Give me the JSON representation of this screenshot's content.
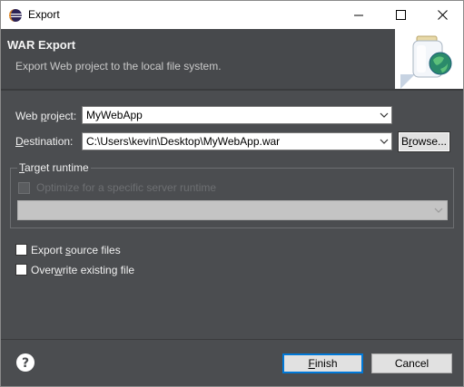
{
  "window": {
    "title": "Export",
    "controls": {
      "minimize": "—",
      "maximize": "☐",
      "close": "✕"
    }
  },
  "banner": {
    "heading": "WAR Export",
    "description": "Export Web project to the local file system."
  },
  "form": {
    "web_project": {
      "label_pre": "Web ",
      "label_accel": "p",
      "label_post": "roject:",
      "value": "MyWebApp"
    },
    "destination": {
      "label_pre": "",
      "label_accel": "D",
      "label_post": "estination:",
      "value": "C:\\Users\\kevin\\Desktop\\MyWebApp.war"
    },
    "browse": {
      "label_pre": "B",
      "label_accel": "r",
      "label_post": "owse..."
    }
  },
  "target_runtime": {
    "legend_pre": "",
    "legend_accel": "T",
    "legend_post": "arget runtime",
    "optimize_label": "Optimize for a specific server runtime",
    "optimize_checked": false,
    "runtime_value": ""
  },
  "options": {
    "export_source": {
      "label_pre": "Export ",
      "label_accel": "s",
      "label_post": "ource files",
      "checked": false
    },
    "overwrite": {
      "label_pre": "Over",
      "label_accel": "w",
      "label_post": "rite existing file",
      "checked": false
    }
  },
  "footer": {
    "help_glyph": "?",
    "finish": {
      "label_pre": "",
      "label_accel": "F",
      "label_post": "inish"
    },
    "cancel": {
      "label": "Cancel"
    }
  },
  "colors": {
    "dialog_bg": "#4b4d50",
    "banner_bg": "#47494c",
    "accent": "#0078d7"
  },
  "icons": {
    "app": "eclipse-icon",
    "banner": "war-export-jar-globe-icon",
    "help": "help-icon",
    "dropdown": "chevron-down-icon"
  }
}
